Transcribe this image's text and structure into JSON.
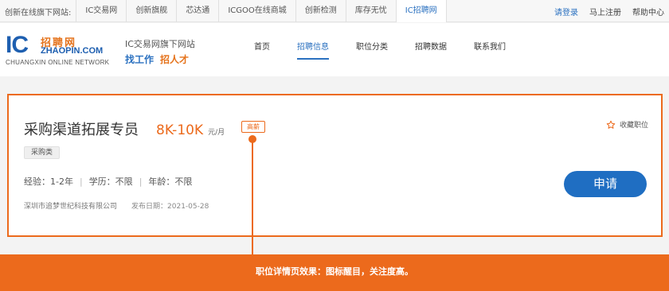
{
  "topbar": {
    "prefix": "创新在线旗下网站:",
    "sites": [
      "IC交易网",
      "创新旗舰",
      "芯达通",
      "ICGOO在线商城",
      "创新检测",
      "库存无忧",
      "IC招聘网"
    ],
    "active_site": "IC招聘网",
    "login": "请登录",
    "register": "马上注册",
    "help": "帮助中心"
  },
  "logo": {
    "ic": "IC",
    "cn": "招聘网",
    "en": "ZHAOPIN.COM",
    "sub": "CHUANGXIN ONLINE NETWORK"
  },
  "slogan": {
    "line1": "IC交易网旗下网站",
    "find_job": "找工作",
    "hire": "招人才"
  },
  "nav": {
    "items": [
      "首页",
      "招聘信息",
      "职位分类",
      "招聘数据",
      "联系我们"
    ],
    "active": "招聘信息"
  },
  "job": {
    "title": "采购渠道拓展专员",
    "salary": "8K-10K",
    "salary_unit": "元/月",
    "badge": "高薪",
    "category": "采购类",
    "experience": "经验：1-2年",
    "education": "学历：不限",
    "age": "年龄：不限",
    "company": "深圳市追梦世纪科技有限公司",
    "publish_date": "发布日期：2021-05-28",
    "favorite_label": "收藏职位",
    "apply_label": "申请"
  },
  "callout": {
    "text": "职位详情页效果：图标醒目，关注度高。"
  },
  "colors": {
    "accent": "#ec6a1c",
    "brand_blue": "#1f6ec2"
  }
}
